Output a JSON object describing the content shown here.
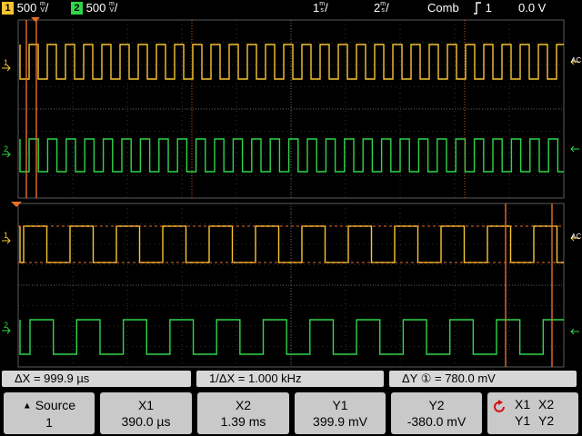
{
  "top_bar": {
    "ch1_badge": "1",
    "ch1_scale": "500",
    "ch1_unit_top": "m",
    "ch1_unit_bottom": "V",
    "ch2_badge": "2",
    "ch2_scale": "500",
    "ch2_unit_top": "m",
    "ch2_unit_bottom": "V",
    "timebase_main_value": "1",
    "timebase_main_unit_top": "m",
    "timebase_main_unit_bottom": "s",
    "timebase_zoom_value": "2",
    "timebase_zoom_unit_top": "m",
    "timebase_zoom_unit_bottom": "s",
    "acq_mode": "Comb",
    "trigger_source": "1",
    "trigger_level": "0.0 V"
  },
  "markers": {
    "ch1_label": "1",
    "ch2_label": "2",
    "coupling_label": "AC"
  },
  "measurements": {
    "delta_x": "ΔX = 999.9 µs",
    "inv_delta_x": "1/ΔX =  1.000 kHz",
    "delta_y": "ΔY ① = 780.0 mV"
  },
  "softkeys": {
    "source_label": "Source",
    "source_value": "1",
    "x1_label": "X1",
    "x1_value": "390.0 µs",
    "x2_label": "X2",
    "x2_value": "1.39 ms",
    "y1_label": "Y1",
    "y1_value": "399.9 mV",
    "y2_label": "Y2",
    "y2_value": "-380.0 mV",
    "pair_x1": "X1",
    "pair_x2": "X2",
    "pair_y1": "Y1",
    "pair_y2": "Y2"
  },
  "colors": {
    "ch1": "#f7c531",
    "ch2": "#2fd64a",
    "cursor": "#e8702a",
    "grid": "#5a5a5a",
    "softkey_bg": "#c9c9c9"
  },
  "icons": {
    "source_arrow": "up-triangle-icon",
    "pair_cycle": "cycle-arrow-icon",
    "trigger_edge": "rising-edge-icon"
  }
}
